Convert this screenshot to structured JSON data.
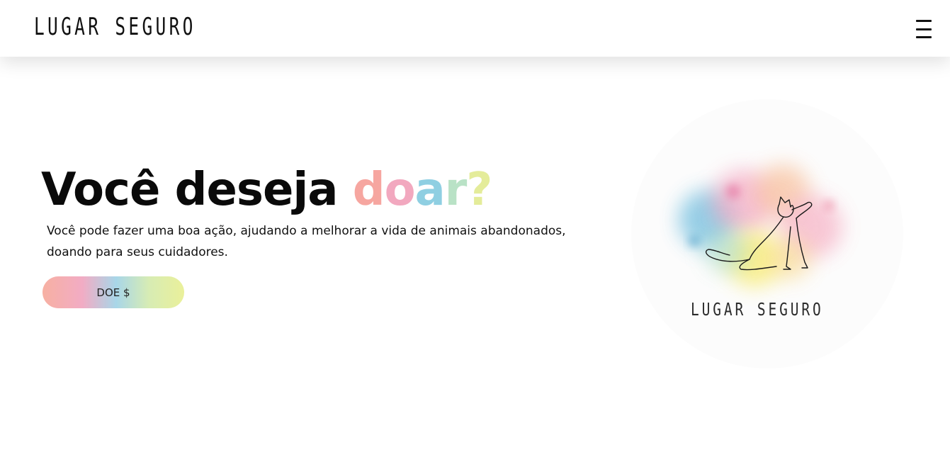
{
  "header": {
    "brand": "LUGAR SEGURO",
    "menu_icon": "hamburger-menu-icon"
  },
  "hero": {
    "title_plain": "Você deseja ",
    "title_colored": [
      "d",
      "o",
      "a",
      "r",
      "?"
    ],
    "description": "Você pode fazer uma boa ação, ajudando a melhorar a vida de animais abandonados, doando para seus cuidadores.",
    "cta_label": "DOE $"
  },
  "logo": {
    "caption": "LUGAR SEGURO",
    "art": "watercolor-cat-logo"
  },
  "colors": {
    "title_gradient": [
      "#f6a6a0",
      "#f2a8bf",
      "#8fcfe2",
      "#b9e2c6",
      "#e4ec9a"
    ],
    "text": "#111111",
    "background": "#ffffff"
  }
}
